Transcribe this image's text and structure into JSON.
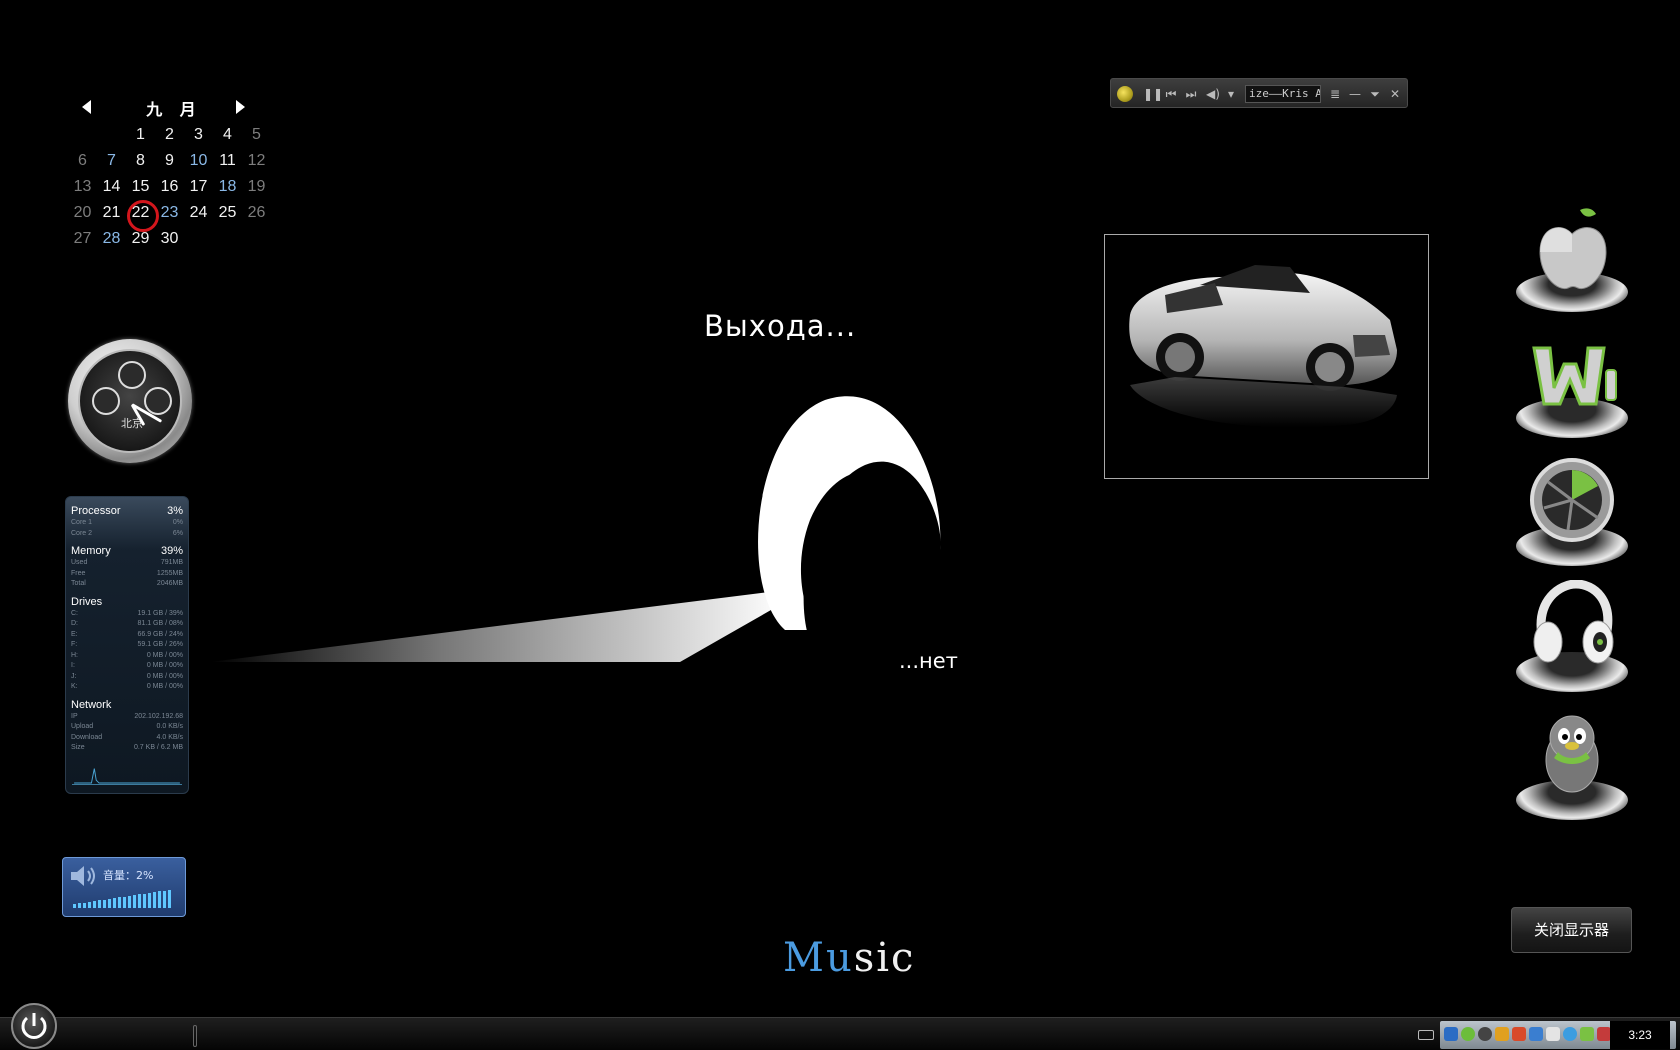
{
  "calendar": {
    "month_label": "九 月",
    "weeks": [
      [
        {
          "d": "",
          "c": "white"
        },
        {
          "d": "",
          "c": "white"
        },
        {
          "d": "1",
          "c": "white"
        },
        {
          "d": "2",
          "c": "white"
        },
        {
          "d": "3",
          "c": "white"
        },
        {
          "d": "4",
          "c": "white"
        },
        {
          "d": "5",
          "c": "grey"
        }
      ],
      [
        {
          "d": "6",
          "c": "grey"
        },
        {
          "d": "7",
          "c": "blue"
        },
        {
          "d": "8",
          "c": "white"
        },
        {
          "d": "9",
          "c": "white"
        },
        {
          "d": "10",
          "c": "blue"
        },
        {
          "d": "11",
          "c": "white"
        },
        {
          "d": "12",
          "c": "grey"
        }
      ],
      [
        {
          "d": "13",
          "c": "grey"
        },
        {
          "d": "14",
          "c": "white"
        },
        {
          "d": "15",
          "c": "white"
        },
        {
          "d": "16",
          "c": "white"
        },
        {
          "d": "17",
          "c": "white"
        },
        {
          "d": "18",
          "c": "blue"
        },
        {
          "d": "19",
          "c": "grey"
        }
      ],
      [
        {
          "d": "20",
          "c": "grey"
        },
        {
          "d": "21",
          "c": "white"
        },
        {
          "d": "22",
          "c": "white today"
        },
        {
          "d": "23",
          "c": "blue"
        },
        {
          "d": "24",
          "c": "white"
        },
        {
          "d": "25",
          "c": "white"
        },
        {
          "d": "26",
          "c": "grey"
        }
      ],
      [
        {
          "d": "27",
          "c": "grey"
        },
        {
          "d": "28",
          "c": "blue"
        },
        {
          "d": "29",
          "c": "white"
        },
        {
          "d": "30",
          "c": "white"
        },
        {
          "d": "",
          "c": "white"
        },
        {
          "d": "",
          "c": "white"
        },
        {
          "d": "",
          "c": "white"
        }
      ]
    ],
    "today": "22"
  },
  "clock": {
    "city": "北京"
  },
  "sysmon": {
    "processor": {
      "label": "Processor",
      "value": "3%",
      "cores": [
        {
          "label": "Core 1",
          "value": "0%"
        },
        {
          "label": "Core 2",
          "value": "6%"
        }
      ]
    },
    "memory": {
      "label": "Memory",
      "value": "39%",
      "rows": [
        {
          "label": "Used",
          "value": "791MB"
        },
        {
          "label": "Free",
          "value": "1255MB"
        },
        {
          "label": "Total",
          "value": "2046MB"
        }
      ]
    },
    "drives": {
      "label": "Drives",
      "rows": [
        {
          "label": "C:",
          "value": "19.1 GB / 39%"
        },
        {
          "label": "D:",
          "value": "81.1 GB / 08%"
        },
        {
          "label": "E:",
          "value": "66.9 GB / 24%"
        },
        {
          "label": "F:",
          "value": "59.1 GB / 26%"
        },
        {
          "label": "H:",
          "value": "0 MB / 00%"
        },
        {
          "label": "I:",
          "value": "0 MB / 00%"
        },
        {
          "label": "J:",
          "value": "0 MB / 00%"
        },
        {
          "label": "K:",
          "value": "0 MB / 00%"
        }
      ]
    },
    "network": {
      "label": "Network",
      "rows": [
        {
          "label": "IP",
          "value": "202.102.192.68"
        },
        {
          "label": "Upload",
          "value": "0.0 KB/s"
        },
        {
          "label": "Download",
          "value": "4.0 KB/s"
        },
        {
          "label": "Size",
          "value": "0.7 KB / 6.2 MB"
        }
      ]
    }
  },
  "volume": {
    "label": "音量：2%",
    "level": 0.02
  },
  "center": {
    "title": "Выхода...",
    "subtitle": "...нет",
    "music_accent": "Mu",
    "music_rest": "sic"
  },
  "player": {
    "track_text": "ize——Kris A",
    "logo_icon": "player-logo-icon"
  },
  "dock": {
    "items": [
      "apple-icon",
      "word-icon",
      "lime-icon",
      "headphones-icon",
      "qq-penguin-icon"
    ]
  },
  "close_display_label": "关闭显示器",
  "taskbar": {
    "time": "3:23"
  },
  "colors": {
    "accent_blue": "#4b9be0",
    "today_ring": "#d3161c",
    "dock_green": "#7ac143"
  }
}
